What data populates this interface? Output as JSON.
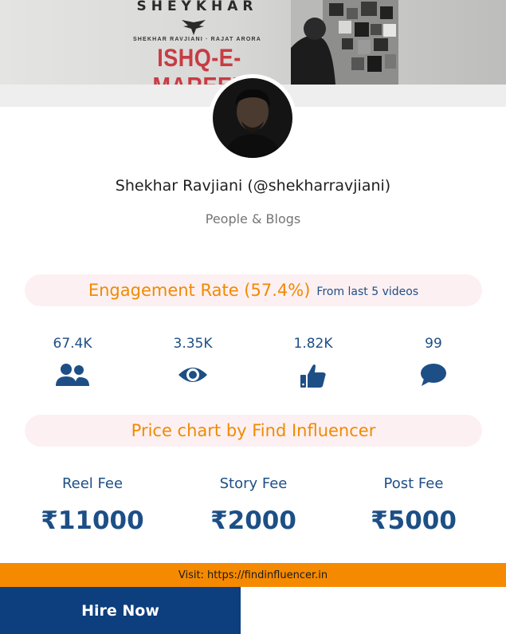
{
  "banner": {
    "brand": "SHEYKHAR",
    "artists": "SHEKHAR RAVJIANI · RAJAT ARORA",
    "album": "ISHQ-E-MAREEZ"
  },
  "profile": {
    "name": "Shekhar Ravjiani (@shekharravjiani)",
    "category": "People & Blogs"
  },
  "engagement": {
    "title": "Engagement Rate (57.4%)",
    "subtitle": "From last 5 videos"
  },
  "stats": [
    {
      "value": "67.4K",
      "icon": "users-icon"
    },
    {
      "value": "3.35K",
      "icon": "eye-icon"
    },
    {
      "value": "1.82K",
      "icon": "thumbs-up-icon"
    },
    {
      "value": "99",
      "icon": "comment-icon"
    }
  ],
  "price_chart": {
    "title": "Price chart by Find Influencer",
    "fees": [
      {
        "label": "Reel Fee",
        "value": "₹11000"
      },
      {
        "label": "Story Fee",
        "value": "₹2000"
      },
      {
        "label": "Post Fee",
        "value": "₹5000"
      }
    ]
  },
  "footer": {
    "visit": "Visit: https://findinfluencer.in",
    "hire_label": "Hire Now"
  },
  "colors": {
    "accent_orange": "#f58a00",
    "primary_blue": "#1d4f86",
    "hire_blue": "#0d3e7d",
    "pill_bg": "#fdf0f2"
  }
}
